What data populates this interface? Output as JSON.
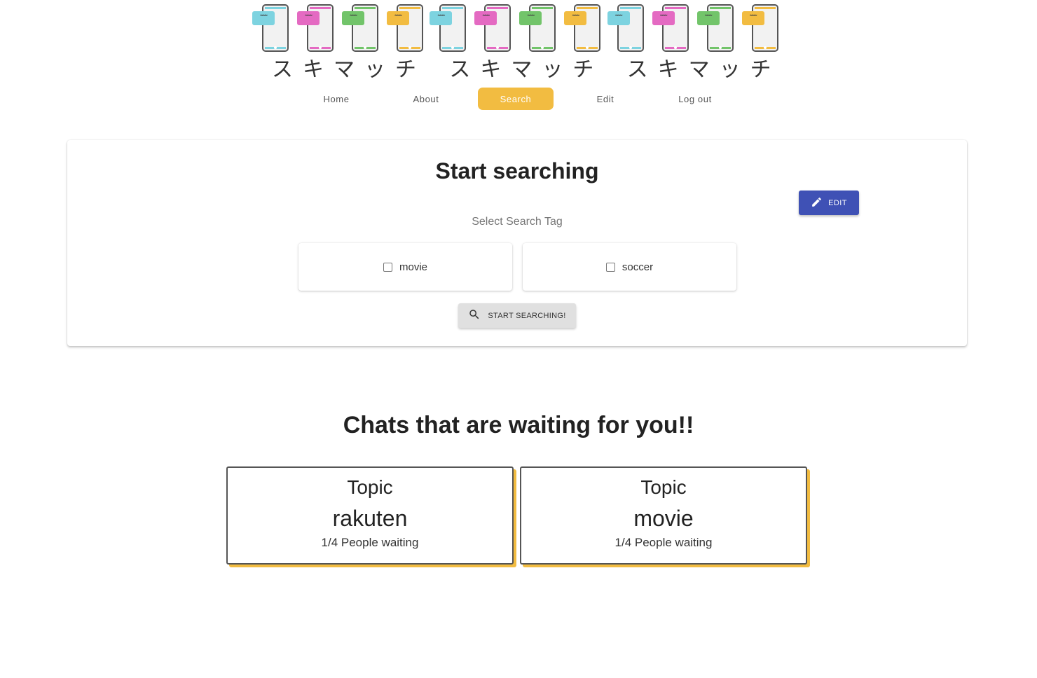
{
  "logo": {
    "groups": [
      {
        "text": "スキマッチ",
        "phones": [
          {
            "bubble": "≈≈≈",
            "color": "#7dd3e0"
          },
          {
            "bubble": "≈≈≈",
            "color": "#e46ac2"
          },
          {
            "bubble": "≈≈≈",
            "color": "#72c46a"
          },
          {
            "bubble": "≈≈≈",
            "color": "#f2bc41"
          }
        ]
      },
      {
        "text": "スキマッチ",
        "phones": [
          {
            "bubble": "≈≈≈",
            "color": "#7dd3e0"
          },
          {
            "bubble": "≈≈≈",
            "color": "#e46ac2"
          },
          {
            "bubble": "≈≈≈",
            "color": "#72c46a"
          },
          {
            "bubble": "≈≈≈",
            "color": "#f2bc41"
          }
        ]
      },
      {
        "text": "スキマッチ",
        "phones": [
          {
            "bubble": "≈≈≈",
            "color": "#7dd3e0"
          },
          {
            "bubble": "≈≈≈",
            "color": "#e46ac2"
          },
          {
            "bubble": "≈≈≈",
            "color": "#72c46a"
          },
          {
            "bubble": "≈≈≈",
            "color": "#f2bc41"
          }
        ]
      }
    ]
  },
  "nav": {
    "items": [
      {
        "label": "Home",
        "name": "home",
        "active": false
      },
      {
        "label": "About",
        "name": "about",
        "active": false
      },
      {
        "label": "Search",
        "name": "search",
        "active": true
      },
      {
        "label": "Edit",
        "name": "edit",
        "active": false
      },
      {
        "label": "Log out",
        "name": "log-out",
        "active": false
      }
    ],
    "active_color": "#f2bc41"
  },
  "search": {
    "title": "Start searching",
    "edit_label": "EDIT",
    "edit_icon": "pencil-icon",
    "tag_label": "Select Search Tag",
    "tags": [
      {
        "label": "movie",
        "checked": false
      },
      {
        "label": "soccer",
        "checked": false
      }
    ],
    "start_label": "START SEARCHING!",
    "start_icon": "search-icon",
    "primary_color": "#3f51b5"
  },
  "chats": {
    "heading": "Chats that are waiting for you!!",
    "items": [
      {
        "topic_label": "Topic",
        "topic": "rakuten",
        "waiting": "1/4 People waiting"
      },
      {
        "topic_label": "Topic",
        "topic": "movie",
        "waiting": "1/4 People waiting"
      }
    ]
  }
}
